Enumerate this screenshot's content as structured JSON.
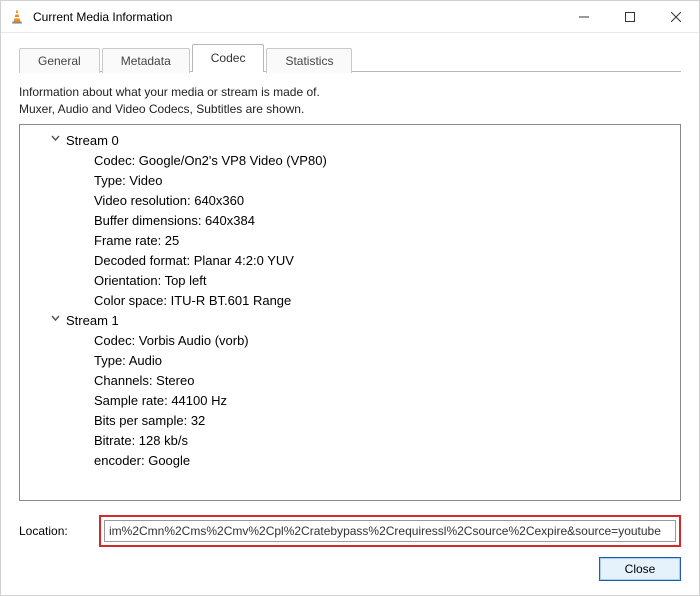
{
  "window": {
    "title": "Current Media Information"
  },
  "tabs": {
    "general": "General",
    "metadata": "Metadata",
    "codec": "Codec",
    "statistics": "Statistics"
  },
  "intro": {
    "line1": "Information about what your media or stream is made of.",
    "line2": "Muxer, Audio and Video Codecs, Subtitles are shown."
  },
  "streams": [
    {
      "name": "Stream 0",
      "rows": [
        "Codec: Google/On2's VP8 Video (VP80)",
        "Type: Video",
        "Video resolution: 640x360",
        "Buffer dimensions: 640x384",
        "Frame rate: 25",
        "Decoded format: Planar 4:2:0 YUV",
        "Orientation: Top left",
        "Color space: ITU-R BT.601 Range"
      ]
    },
    {
      "name": "Stream 1",
      "rows": [
        "Codec: Vorbis Audio (vorb)",
        "Type: Audio",
        "Channels: Stereo",
        "Sample rate: 44100 Hz",
        "Bits per sample: 32",
        "Bitrate: 128 kb/s",
        "encoder: Google"
      ]
    }
  ],
  "location": {
    "label": "Location:",
    "value": "im%2Cmn%2Cms%2Cmv%2Cpl%2Cratebypass%2Crequiressl%2Csource%2Cexpire&source=youtube"
  },
  "buttons": {
    "close": "Close"
  }
}
